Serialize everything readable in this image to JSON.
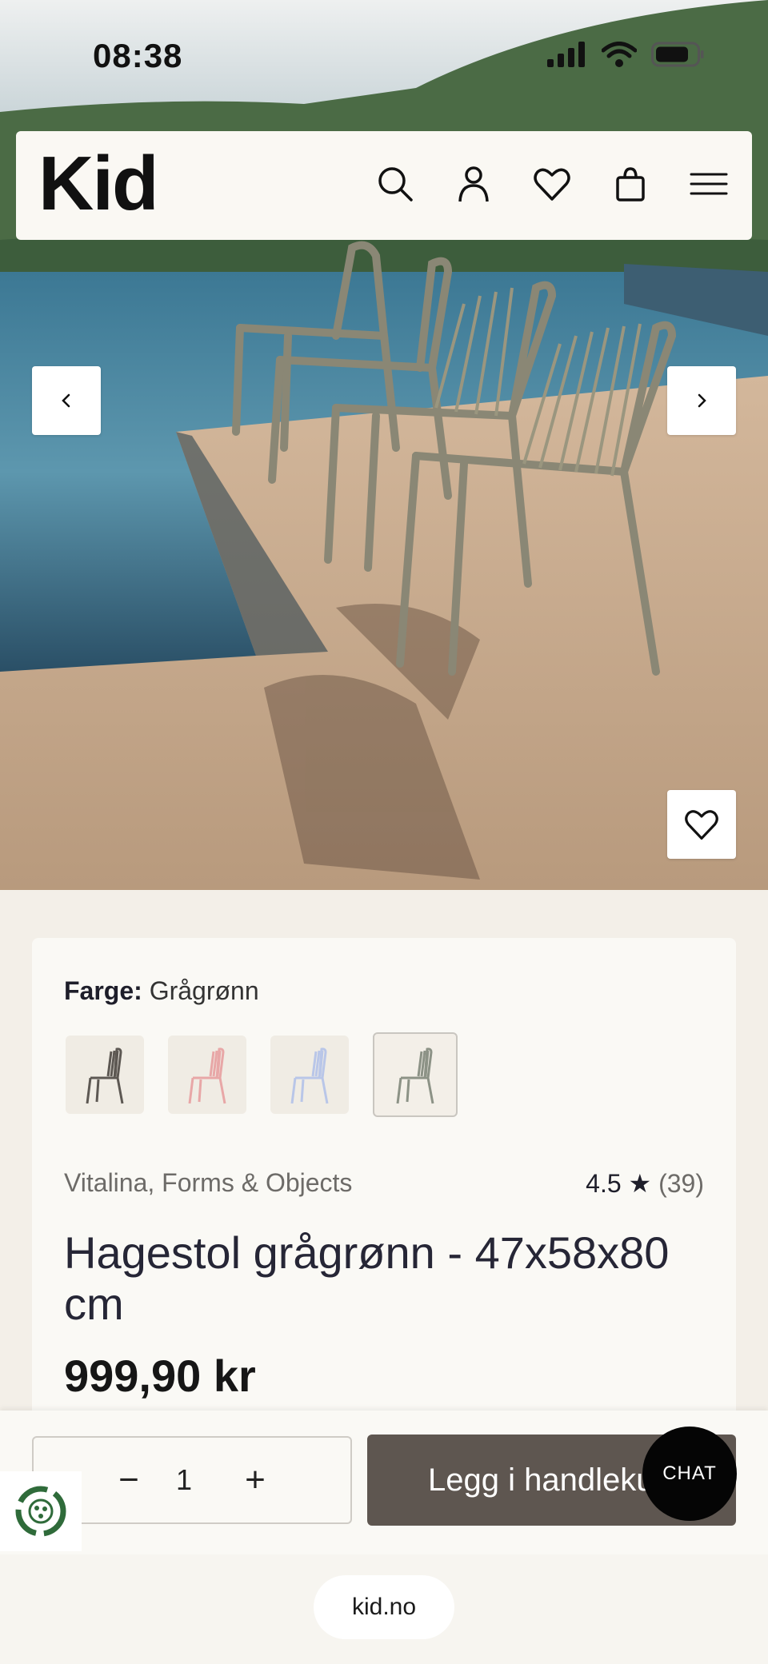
{
  "status_bar": {
    "time": "08:38"
  },
  "header": {
    "logo": "Kid",
    "icons": [
      "search-icon",
      "account-icon",
      "wishlist-icon",
      "bag-icon",
      "menu-icon"
    ]
  },
  "product": {
    "color_label": "Farge:",
    "color_value": "Grågrønn",
    "swatches": [
      {
        "name": "dark-grey",
        "color": "#5d5853"
      },
      {
        "name": "pink",
        "color": "#e8a7a7"
      },
      {
        "name": "light-blue",
        "color": "#b9c6e8"
      },
      {
        "name": "grey-green",
        "color": "#8c9286",
        "selected": true
      }
    ],
    "brand": "Vitalina, Forms & Objects",
    "rating_value": "4.5",
    "rating_star": "★",
    "rating_count": "(39)",
    "title": "Hagestol grågrønn - 47x58x80 cm",
    "price": "999,90 kr"
  },
  "cart": {
    "minus": "−",
    "quantity": "1",
    "plus": "+",
    "add_label": "Legg i handlekurv"
  },
  "chat": {
    "label": "CHAT"
  },
  "browser": {
    "url": "kid.no"
  },
  "colors": {
    "accent_button": "#5e5650",
    "background": "#f3efe8",
    "card": "#faf9f5"
  }
}
